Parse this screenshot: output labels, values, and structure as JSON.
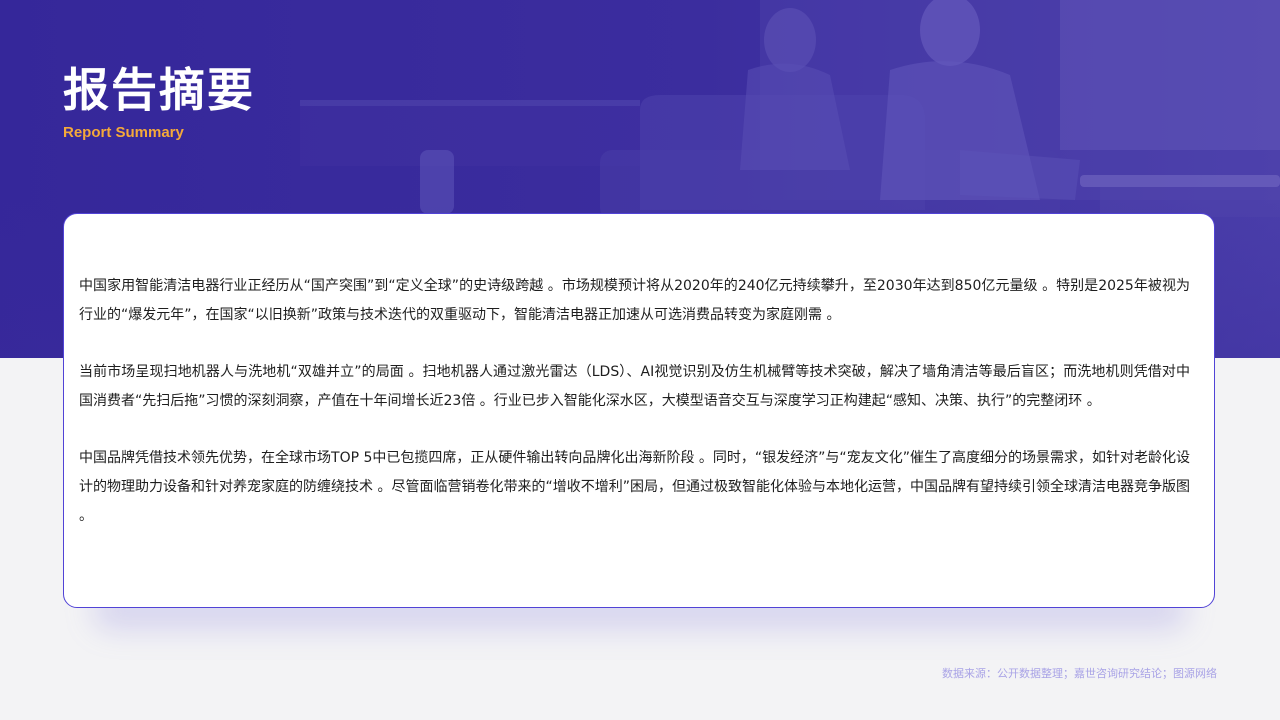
{
  "header": {
    "title": "报告摘要",
    "subtitle": "Report Summary"
  },
  "summary": {
    "paragraphs": [
      "中国家用智能清洁电器行业正经历从“国产突围”到“定义全球”的史诗级跨越 。市场规模预计将从2020年的240亿元持续攀升，至2030年达到850亿元量级 。特别是2025年被视为行业的“爆发元年”，在国家“以旧换新”政策与技术迭代的双重驱动下，智能清洁电器正加速从可选消费品转变为家庭刚需 。",
      "当前市场呈现扫地机器人与洗地机“双雄并立”的局面 。扫地机器人通过激光雷达（LDS）、AI视觉识别及仿生机械臂等技术突破，解决了墙角清洁等最后盲区；而洗地机则凭借对中国消费者“先扫后拖”习惯的深刻洞察，产值在十年间增长近23倍 。行业已步入智能化深水区，大模型语音交互与深度学习正构建起“感知、决策、执行”的完整闭环 。",
      "中国品牌凭借技术领先优势，在全球市场TOP 5中已包揽四席，正从硬件输出转向品牌化出海新阶段 。同时，“银发经济”与“宠友文化”催生了高度细分的场景需求，如针对老龄化设计的物理助力设备和针对养宠家庭的防缠绕技术 。尽管面临营销卷化带来的“增收不增利”困局，但通过极致智能化体验与本地化运营，中国品牌有望持续引领全球清洁电器竞争版图 。"
    ]
  },
  "footer": {
    "source": "数据来源：公开数据整理；嘉世咨询研究结论；图源网络"
  },
  "colors": {
    "hero_bg": "#3b2c9c",
    "accent": "#5143d6",
    "subtitle": "#f4a93a",
    "source_text": "#a9a3e6"
  }
}
